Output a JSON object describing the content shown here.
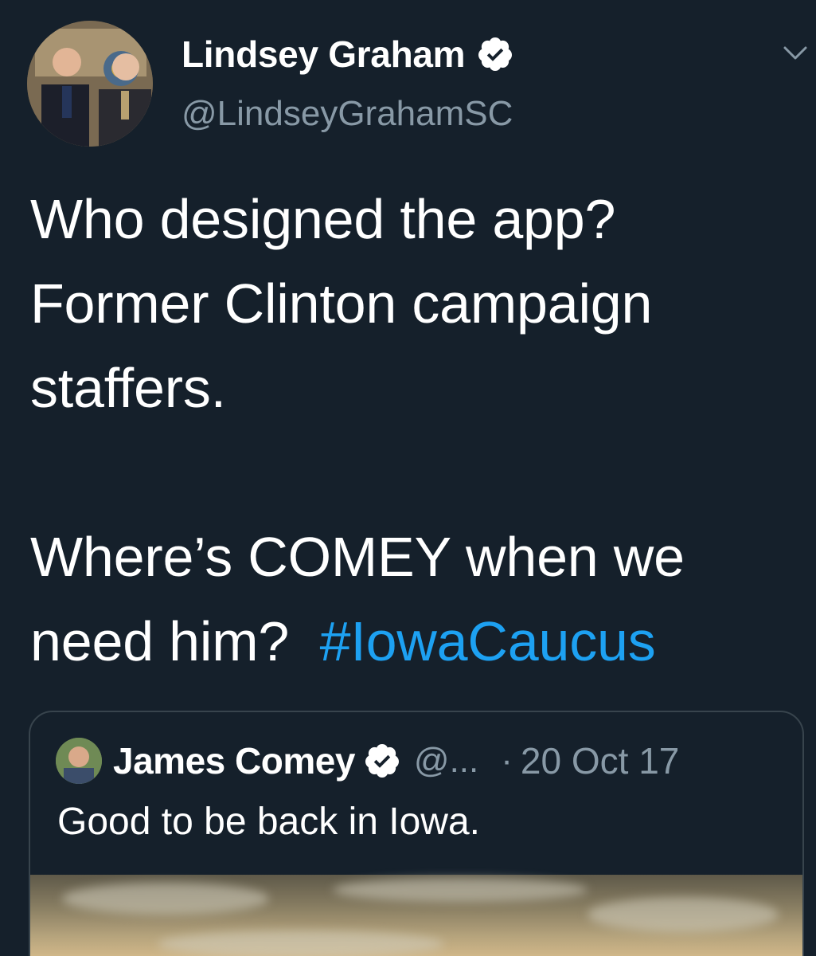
{
  "tweet": {
    "author_name": "Lindsey Graham",
    "author_handle": "@LindseyGrahamSC",
    "verified_icon": "verified-badge-icon",
    "menu_icon": "chevron-down-icon",
    "lines": [
      "Who designed the app?",
      "Former Clinton campaign",
      "staffers.",
      "",
      "Where’s COMEY when we",
      "need him?  "
    ],
    "hashtag": "#IowaCaucus"
  },
  "quote": {
    "author_name": "James Comey",
    "author_handle": "@...",
    "separator": "·",
    "date": "20 Oct 17",
    "text": "Good to be back in Iowa."
  },
  "colors": {
    "background": "#15202b",
    "text": "#ffffff",
    "secondary": "#8899a6",
    "link": "#1da1f2",
    "border": "#38444d"
  }
}
